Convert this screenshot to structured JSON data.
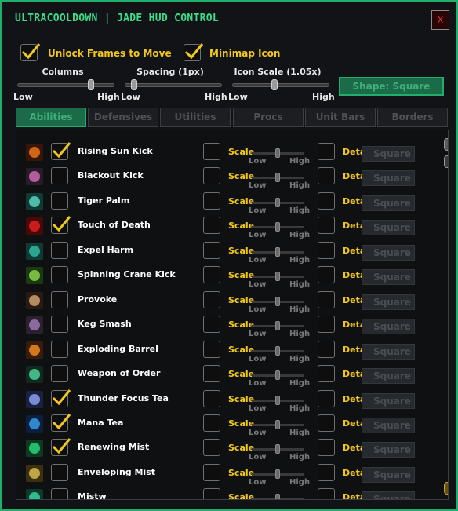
{
  "window": {
    "title": "ULTRACOOLDOWN | JADE HUD CONTROL",
    "close_label": "X"
  },
  "options": {
    "unlock": {
      "label": "Unlock Frames to Move",
      "checked": true
    },
    "minimap": {
      "label": "Minimap Icon",
      "checked": true
    }
  },
  "sliders": [
    {
      "label": "Columns",
      "low": "Low",
      "high": "High",
      "value": 0.78
    },
    {
      "label": "Spacing (1px)",
      "low": "Low",
      "high": "High",
      "value": 0.06
    },
    {
      "label": "Icon Scale (1.05x)",
      "low": "Low",
      "high": "High",
      "value": 0.43
    }
  ],
  "shape_button": "Shape: Square",
  "tabs": [
    "Abilities",
    "Defensives",
    "Utilities",
    "Procs",
    "Unit Bars",
    "Borders"
  ],
  "active_tab": "Abilities",
  "row_labels": {
    "scale": "Scale",
    "low": "Low",
    "high": "High",
    "detach": "Detach",
    "shape": "Square"
  },
  "abilities": [
    {
      "name": "Rising Sun Kick",
      "checked": true,
      "colors": [
        "#3a1408",
        "#e8741a"
      ]
    },
    {
      "name": "Blackout Kick",
      "checked": false,
      "colors": [
        "#2a1a2a",
        "#c86ab0"
      ]
    },
    {
      "name": "Tiger Palm",
      "checked": false,
      "colors": [
        "#0f3a34",
        "#5ad2c0"
      ]
    },
    {
      "name": "Touch of Death",
      "checked": true,
      "colors": [
        "#4a0808",
        "#e02020"
      ]
    },
    {
      "name": "Expel Harm",
      "checked": false,
      "colors": [
        "#0f3a34",
        "#2fb8a0"
      ]
    },
    {
      "name": "Spinning Crane Kick",
      "checked": false,
      "colors": [
        "#1a3a10",
        "#8ad24a"
      ]
    },
    {
      "name": "Provoke",
      "checked": false,
      "colors": [
        "#2a1a14",
        "#d0a070"
      ]
    },
    {
      "name": "Keg Smash",
      "checked": false,
      "colors": [
        "#2a2030",
        "#9a7ab0"
      ]
    },
    {
      "name": "Exploding Barrel",
      "checked": false,
      "colors": [
        "#3a1a08",
        "#f08a20"
      ]
    },
    {
      "name": "Weapon of Order",
      "checked": false,
      "colors": [
        "#102a20",
        "#4ad29a"
      ]
    },
    {
      "name": "Thunder Focus Tea",
      "checked": true,
      "colors": [
        "#1a2040",
        "#8aa0f0"
      ]
    },
    {
      "name": "Mana Tea",
      "checked": true,
      "colors": [
        "#0a2040",
        "#3a9ae8"
      ]
    },
    {
      "name": "Renewing Mist",
      "checked": true,
      "colors": [
        "#0a3a20",
        "#2ad27a"
      ]
    },
    {
      "name": "Enveloping Mist",
      "checked": false,
      "colors": [
        "#3a3010",
        "#d8b850"
      ]
    },
    {
      "name": "Mistw",
      "checked": false,
      "colors": [
        "#0a3a2a",
        "#3ad2a0"
      ]
    }
  ],
  "colors": {
    "accent": "#1fae6c",
    "yellow": "#f2c81a",
    "title": "#3ddc8a"
  }
}
